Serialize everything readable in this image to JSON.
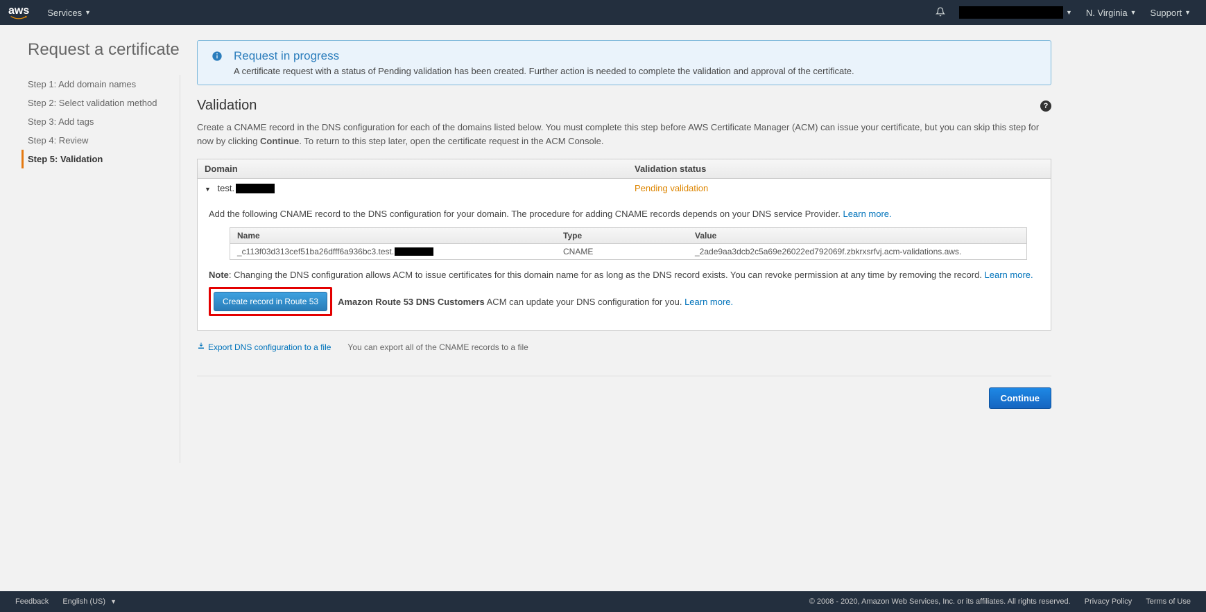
{
  "nav": {
    "services": "Services",
    "region": "N. Virginia",
    "support": "Support"
  },
  "page": {
    "title": "Request a certificate"
  },
  "steps": [
    "Step 1: Add domain names",
    "Step 2: Select validation method",
    "Step 3: Add tags",
    "Step 4: Review",
    "Step 5: Validation"
  ],
  "banner": {
    "title": "Request in progress",
    "message": "A certificate request with a status of Pending validation has been created. Further action is needed to complete the validation and approval of the certificate."
  },
  "section": {
    "title": "Validation",
    "desc_pre": "Create a CNAME record in the DNS configuration for each of the domains listed below. You must complete this step before AWS Certificate Manager (ACM) can issue your certificate, but you can skip this step for now by clicking ",
    "desc_bold": "Continue",
    "desc_post": ". To return to this step later, open the certificate request in the ACM Console."
  },
  "table": {
    "col_domain": "Domain",
    "col_status": "Validation status",
    "domain_prefix": "test.",
    "status": "Pending validation"
  },
  "detail": {
    "instructions": "Add the following CNAME record to the DNS configuration for your domain. The procedure for adding CNAME records depends on your DNS service Provider. ",
    "learn_more": "Learn more.",
    "rec_col_name": "Name",
    "rec_col_type": "Type",
    "rec_col_value": "Value",
    "rec_name_prefix": "_c113f03d313cef51ba26dfff6a936bc3.test.",
    "rec_type": "CNAME",
    "rec_value": "_2ade9aa3dcb2c5a69e26022ed792069f.zbkrxsrfvj.acm-validations.aws.",
    "note_bold": "Note",
    "note_text": ": Changing the DNS configuration allows ACM to issue certificates for this domain name for as long as the DNS record exists. You can revoke permission at any time by removing the record. ",
    "cta_button": "Create record in Route 53",
    "cta_bold": "Amazon Route 53 DNS Customers",
    "cta_text": " ACM can update your DNS configuration for you. "
  },
  "export": {
    "link": "Export DNS configuration to a file",
    "help": "You can export all of the CNAME records to a file"
  },
  "actions": {
    "continue": "Continue"
  },
  "footer": {
    "feedback": "Feedback",
    "language": "English (US)",
    "copyright": "© 2008 - 2020, Amazon Web Services, Inc. or its affiliates. All rights reserved.",
    "privacy": "Privacy Policy",
    "terms": "Terms of Use"
  }
}
